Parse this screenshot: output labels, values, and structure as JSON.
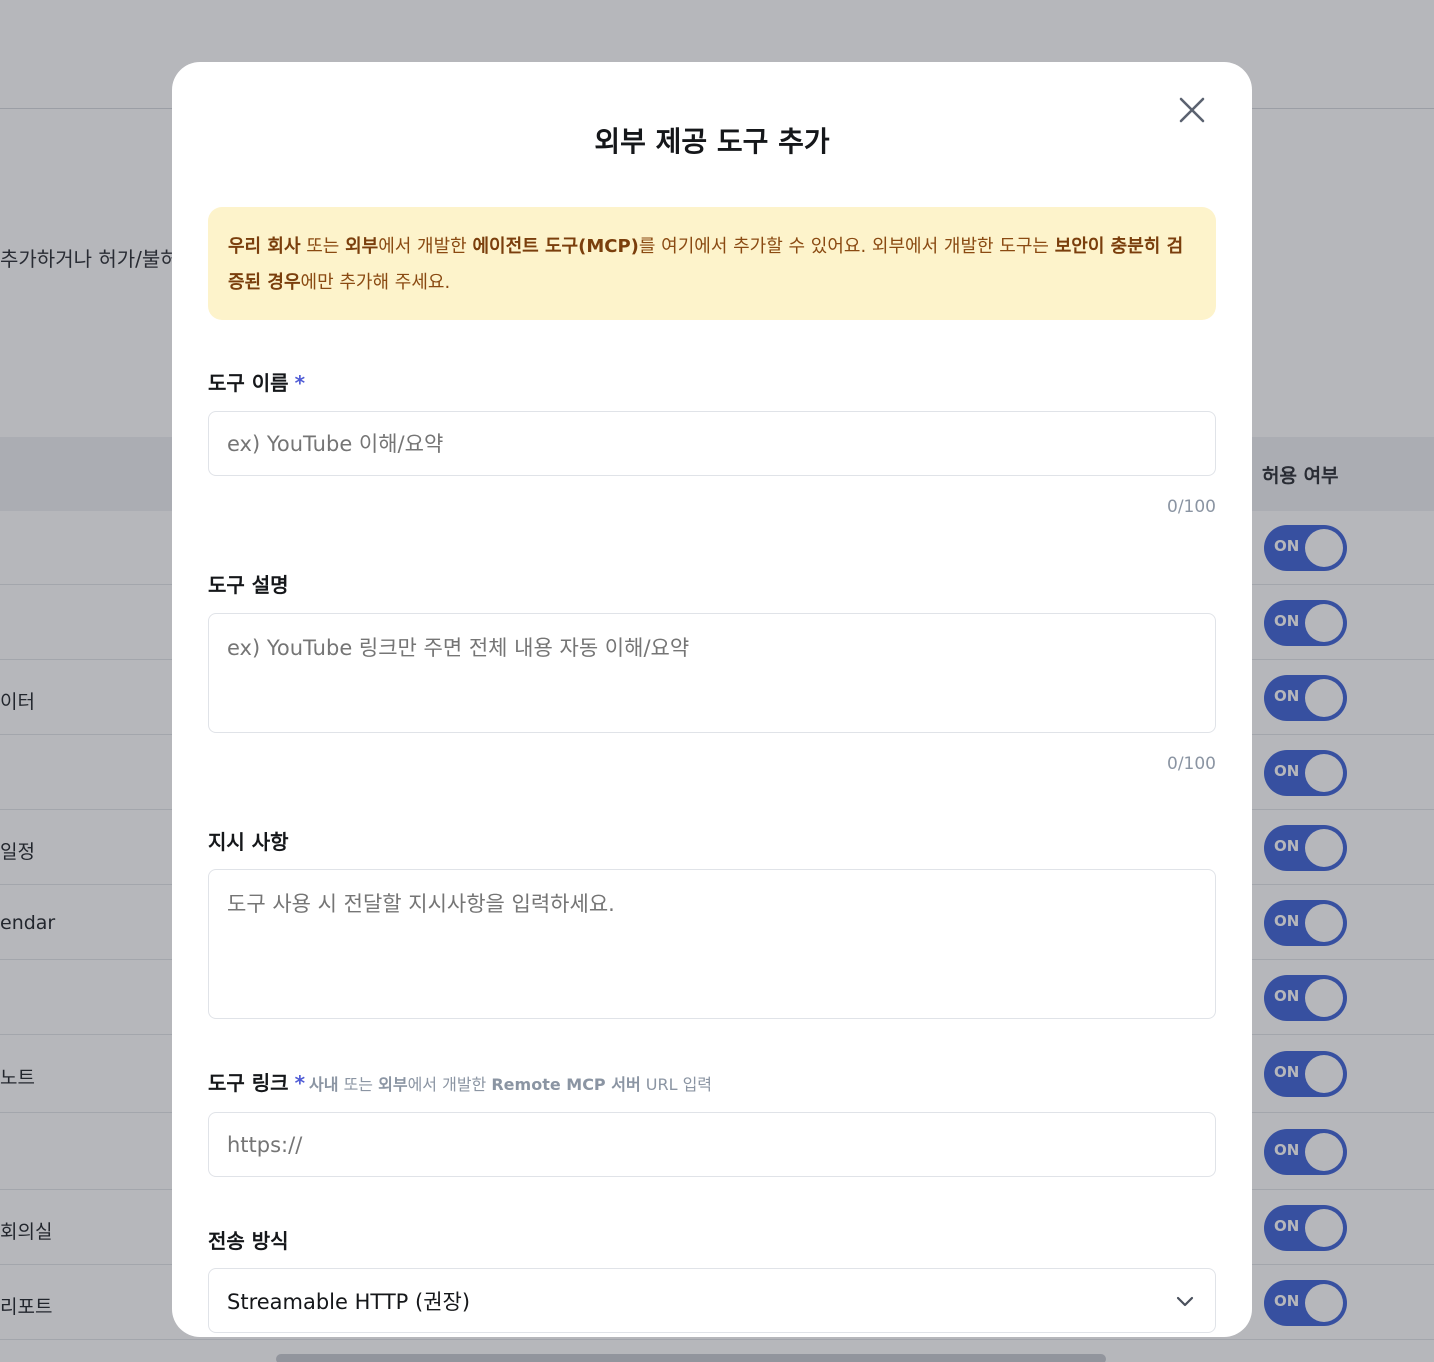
{
  "background": {
    "description_fragment": "추가하거나 허가/불허",
    "column_allow": "허용 여부",
    "rows": [
      {
        "label": ""
      },
      {
        "label": ""
      },
      {
        "label": "이터"
      },
      {
        "label": ""
      },
      {
        "label": "일정"
      },
      {
        "label": "endar"
      },
      {
        "label": ""
      },
      {
        "label": "노트"
      },
      {
        "label": ""
      },
      {
        "label": "회의실"
      },
      {
        "label": "리포트"
      }
    ],
    "toggle_label": "ON"
  },
  "modal": {
    "title": "외부 제공 도구 추가",
    "close_icon": "close-icon",
    "notice": {
      "p1": "우리 회사",
      "p2": " 또는 ",
      "p3": "외부",
      "p4": "에서 개발한 ",
      "p5": "에이전트 도구(MCP)",
      "p6": "를 여기에서 추가할 수 있어요. 외부에서 개발한 도구는 ",
      "p7": "보안이 충분히 검증된 경우",
      "p8": "에만 추가해 주세요."
    },
    "tool_name": {
      "label": "도구 이름",
      "required_mark": "*",
      "placeholder": "ex) YouTube 이해/요약",
      "counter": "0/100"
    },
    "tool_description": {
      "label": "도구 설명",
      "placeholder": "ex) YouTube 링크만 주면 전체 내용 자동 이해/요약",
      "counter": "0/100"
    },
    "instructions": {
      "label": "지시 사항",
      "placeholder": "도구 사용 시 전달할 지시사항을 입력하세요."
    },
    "tool_link": {
      "label": "도구 링크",
      "required_mark": "*",
      "hint_p1": "사내",
      "hint_p2": " 또는 ",
      "hint_p3": "외부",
      "hint_p4": "에서 개발한 ",
      "hint_p5": "Remote MCP 서버",
      "hint_p6": " URL 입력",
      "placeholder": "https://"
    },
    "transport": {
      "label": "전송 방식",
      "selected": "Streamable HTTP (권장)"
    }
  }
}
